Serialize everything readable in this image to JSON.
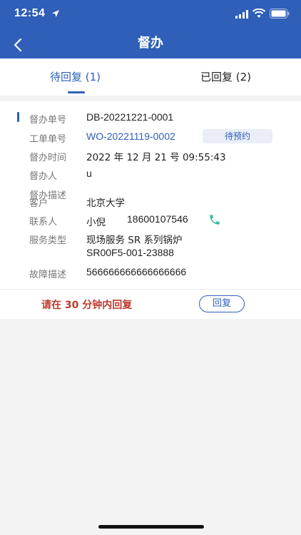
{
  "status_bar": {
    "time": "12:54"
  },
  "nav": {
    "title": "督办"
  },
  "tabs": [
    {
      "label": "待回复 (1)"
    },
    {
      "label": "已回复 (2)"
    }
  ],
  "record": {
    "fields": [
      {
        "label": "督办单号",
        "value": "DB-20221221-0001"
      },
      {
        "label": "工单单号",
        "value": "WO-20221119-0002",
        "badge": "待预约"
      },
      {
        "label": "督办时间",
        "value": "2022 年 12 月 21 号 09:55:43"
      },
      {
        "label": "督办人",
        "value": "u"
      },
      {
        "label": "督办描述",
        "value": ""
      },
      {
        "label": "客户",
        "value": "北京大学"
      },
      {
        "label": "联系人",
        "value": "小倪",
        "phone": "18600107546"
      },
      {
        "label": "服务类型",
        "value": "现场服务   SR 系列锅炉",
        "value2": "SR00F5-001-23888"
      },
      {
        "label": "故障描述",
        "value": "566666666666666666"
      }
    ],
    "hint": "请在 30 分钟内回复",
    "reply_label": "回复"
  },
  "colors": {
    "primary": "#2f5fb8",
    "hint": "#c0392b"
  }
}
